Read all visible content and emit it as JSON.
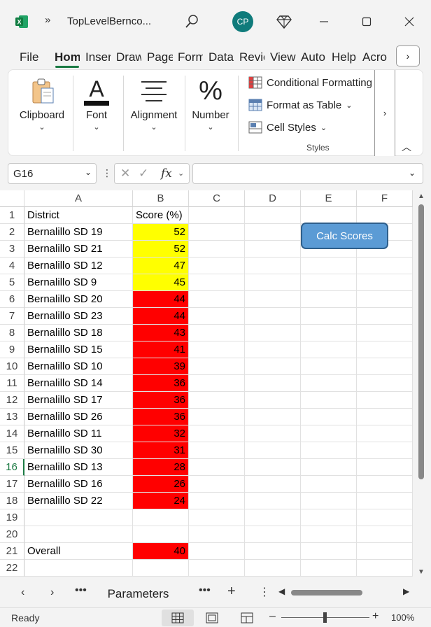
{
  "titlebar": {
    "app_icon": "excel-logo-icon",
    "overflow": "»",
    "title": "TopLevelBernco...",
    "avatar_initials": "CP"
  },
  "ribbon_tabs": [
    "File",
    "Hom",
    "Inser",
    "Draw",
    "Page",
    "Form",
    "Data",
    "Revie",
    "View",
    "Auto",
    "Help",
    "Acro"
  ],
  "ribbon": {
    "groups": {
      "clipboard": "Clipboard",
      "font": "Font",
      "alignment": "Alignment",
      "number": "Number"
    },
    "styles_items": {
      "conditional": "Conditional Formatting",
      "format_table": "Format as Table",
      "cell_styles": "Cell Styles"
    },
    "styles_label": "Styles"
  },
  "formula_bar": {
    "name_box": "G16",
    "fx": "fx",
    "formula": ""
  },
  "grid": {
    "columns": [
      "A",
      "B",
      "C",
      "D",
      "E",
      "F"
    ],
    "rows": [
      "1",
      "2",
      "3",
      "4",
      "5",
      "6",
      "7",
      "8",
      "9",
      "10",
      "11",
      "12",
      "13",
      "14",
      "15",
      "16",
      "17",
      "18",
      "19",
      "20",
      "21",
      "22"
    ],
    "header_row": {
      "a": "District",
      "b": "Score (%)"
    },
    "data": [
      {
        "district": "Bernalillo SD 19",
        "score": "52",
        "color": "#ffff00"
      },
      {
        "district": "Bernalillo SD 21",
        "score": "52",
        "color": "#ffff00"
      },
      {
        "district": "Bernalillo SD 12",
        "score": "47",
        "color": "#ffff00"
      },
      {
        "district": "Bernalillo SD 9",
        "score": "45",
        "color": "#ffff00"
      },
      {
        "district": "Bernalillo SD 20",
        "score": "44",
        "color": "#ff0000"
      },
      {
        "district": "Bernalillo SD 23",
        "score": "44",
        "color": "#ff0000"
      },
      {
        "district": "Bernalillo SD 18",
        "score": "43",
        "color": "#ff0000"
      },
      {
        "district": "Bernalillo SD 15",
        "score": "41",
        "color": "#ff0000"
      },
      {
        "district": "Bernalillo SD 10",
        "score": "39",
        "color": "#ff0000"
      },
      {
        "district": "Bernalillo SD 14",
        "score": "36",
        "color": "#ff0000"
      },
      {
        "district": "Bernalillo SD 17",
        "score": "36",
        "color": "#ff0000"
      },
      {
        "district": "Bernalillo SD 26",
        "score": "36",
        "color": "#ff0000"
      },
      {
        "district": "Bernalillo SD 11",
        "score": "32",
        "color": "#ff0000"
      },
      {
        "district": "Bernalillo SD 30",
        "score": "31",
        "color": "#ff0000"
      },
      {
        "district": "Bernalillo SD 13",
        "score": "28",
        "color": "#ff0000"
      },
      {
        "district": "Bernalillo SD 16",
        "score": "26",
        "color": "#ff0000"
      },
      {
        "district": "Bernalillo SD 22",
        "score": "24",
        "color": "#ff0000"
      }
    ],
    "overall": {
      "label": "Overall",
      "score": "40",
      "color": "#ff0000"
    },
    "selected_row": "16",
    "calc_button": "Calc Scores"
  },
  "sheet_tabs": {
    "active": "Parameters"
  },
  "status": {
    "ready": "Ready",
    "zoom": "100%"
  },
  "colors": {
    "accent": "#1b7a43",
    "yellow": "#ffff00",
    "red": "#ff0000",
    "button": "#5b9bd5"
  }
}
